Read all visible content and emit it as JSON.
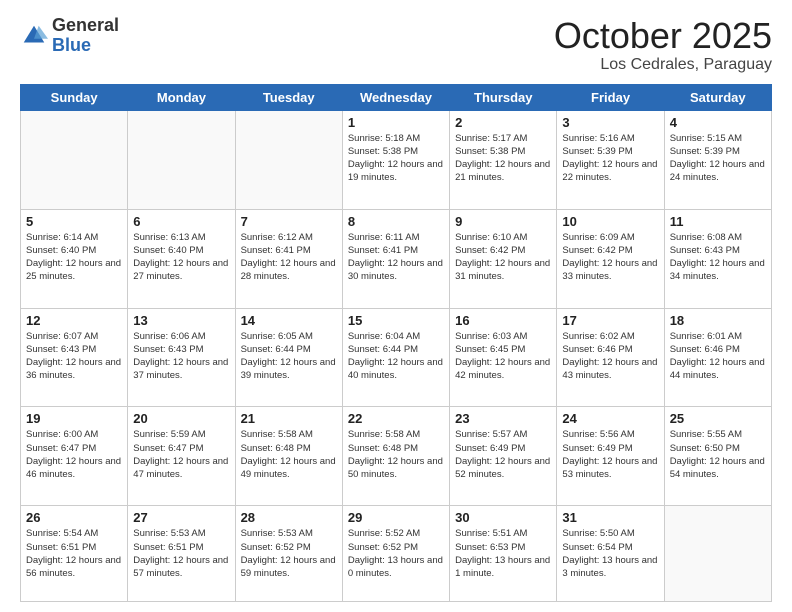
{
  "header": {
    "logo_general": "General",
    "logo_blue": "Blue",
    "month": "October 2025",
    "location": "Los Cedrales, Paraguay"
  },
  "weekdays": [
    "Sunday",
    "Monday",
    "Tuesday",
    "Wednesday",
    "Thursday",
    "Friday",
    "Saturday"
  ],
  "weeks": [
    [
      {
        "day": "",
        "info": ""
      },
      {
        "day": "",
        "info": ""
      },
      {
        "day": "",
        "info": ""
      },
      {
        "day": "1",
        "info": "Sunrise: 5:18 AM\nSunset: 5:38 PM\nDaylight: 12 hours\nand 19 minutes."
      },
      {
        "day": "2",
        "info": "Sunrise: 5:17 AM\nSunset: 5:38 PM\nDaylight: 12 hours\nand 21 minutes."
      },
      {
        "day": "3",
        "info": "Sunrise: 5:16 AM\nSunset: 5:39 PM\nDaylight: 12 hours\nand 22 minutes."
      },
      {
        "day": "4",
        "info": "Sunrise: 5:15 AM\nSunset: 5:39 PM\nDaylight: 12 hours\nand 24 minutes."
      }
    ],
    [
      {
        "day": "5",
        "info": "Sunrise: 6:14 AM\nSunset: 6:40 PM\nDaylight: 12 hours\nand 25 minutes."
      },
      {
        "day": "6",
        "info": "Sunrise: 6:13 AM\nSunset: 6:40 PM\nDaylight: 12 hours\nand 27 minutes."
      },
      {
        "day": "7",
        "info": "Sunrise: 6:12 AM\nSunset: 6:41 PM\nDaylight: 12 hours\nand 28 minutes."
      },
      {
        "day": "8",
        "info": "Sunrise: 6:11 AM\nSunset: 6:41 PM\nDaylight: 12 hours\nand 30 minutes."
      },
      {
        "day": "9",
        "info": "Sunrise: 6:10 AM\nSunset: 6:42 PM\nDaylight: 12 hours\nand 31 minutes."
      },
      {
        "day": "10",
        "info": "Sunrise: 6:09 AM\nSunset: 6:42 PM\nDaylight: 12 hours\nand 33 minutes."
      },
      {
        "day": "11",
        "info": "Sunrise: 6:08 AM\nSunset: 6:43 PM\nDaylight: 12 hours\nand 34 minutes."
      }
    ],
    [
      {
        "day": "12",
        "info": "Sunrise: 6:07 AM\nSunset: 6:43 PM\nDaylight: 12 hours\nand 36 minutes."
      },
      {
        "day": "13",
        "info": "Sunrise: 6:06 AM\nSunset: 6:43 PM\nDaylight: 12 hours\nand 37 minutes."
      },
      {
        "day": "14",
        "info": "Sunrise: 6:05 AM\nSunset: 6:44 PM\nDaylight: 12 hours\nand 39 minutes."
      },
      {
        "day": "15",
        "info": "Sunrise: 6:04 AM\nSunset: 6:44 PM\nDaylight: 12 hours\nand 40 minutes."
      },
      {
        "day": "16",
        "info": "Sunrise: 6:03 AM\nSunset: 6:45 PM\nDaylight: 12 hours\nand 42 minutes."
      },
      {
        "day": "17",
        "info": "Sunrise: 6:02 AM\nSunset: 6:46 PM\nDaylight: 12 hours\nand 43 minutes."
      },
      {
        "day": "18",
        "info": "Sunrise: 6:01 AM\nSunset: 6:46 PM\nDaylight: 12 hours\nand 44 minutes."
      }
    ],
    [
      {
        "day": "19",
        "info": "Sunrise: 6:00 AM\nSunset: 6:47 PM\nDaylight: 12 hours\nand 46 minutes."
      },
      {
        "day": "20",
        "info": "Sunrise: 5:59 AM\nSunset: 6:47 PM\nDaylight: 12 hours\nand 47 minutes."
      },
      {
        "day": "21",
        "info": "Sunrise: 5:58 AM\nSunset: 6:48 PM\nDaylight: 12 hours\nand 49 minutes."
      },
      {
        "day": "22",
        "info": "Sunrise: 5:58 AM\nSunset: 6:48 PM\nDaylight: 12 hours\nand 50 minutes."
      },
      {
        "day": "23",
        "info": "Sunrise: 5:57 AM\nSunset: 6:49 PM\nDaylight: 12 hours\nand 52 minutes."
      },
      {
        "day": "24",
        "info": "Sunrise: 5:56 AM\nSunset: 6:49 PM\nDaylight: 12 hours\nand 53 minutes."
      },
      {
        "day": "25",
        "info": "Sunrise: 5:55 AM\nSunset: 6:50 PM\nDaylight: 12 hours\nand 54 minutes."
      }
    ],
    [
      {
        "day": "26",
        "info": "Sunrise: 5:54 AM\nSunset: 6:51 PM\nDaylight: 12 hours\nand 56 minutes."
      },
      {
        "day": "27",
        "info": "Sunrise: 5:53 AM\nSunset: 6:51 PM\nDaylight: 12 hours\nand 57 minutes."
      },
      {
        "day": "28",
        "info": "Sunrise: 5:53 AM\nSunset: 6:52 PM\nDaylight: 12 hours\nand 59 minutes."
      },
      {
        "day": "29",
        "info": "Sunrise: 5:52 AM\nSunset: 6:52 PM\nDaylight: 13 hours\nand 0 minutes."
      },
      {
        "day": "30",
        "info": "Sunrise: 5:51 AM\nSunset: 6:53 PM\nDaylight: 13 hours\nand 1 minute."
      },
      {
        "day": "31",
        "info": "Sunrise: 5:50 AM\nSunset: 6:54 PM\nDaylight: 13 hours\nand 3 minutes."
      },
      {
        "day": "",
        "info": ""
      }
    ]
  ]
}
